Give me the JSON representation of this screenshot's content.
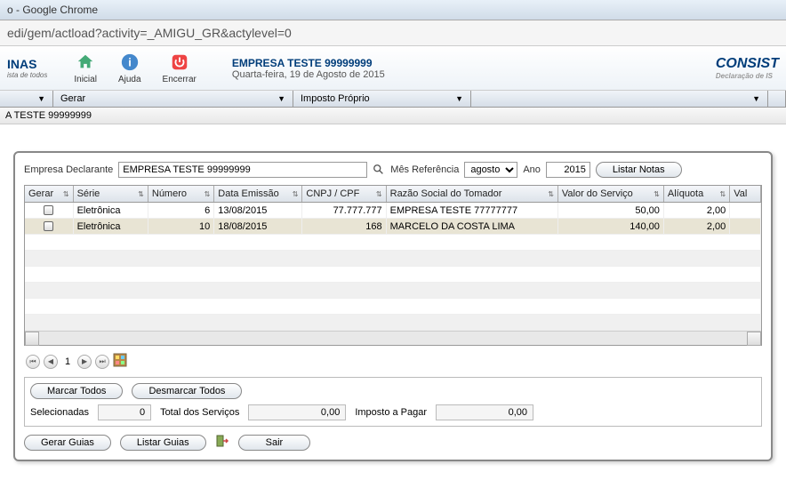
{
  "browser": {
    "title_suffix": "o - Google Chrome",
    "url": "edi/gem/actload?activity=_AMIGU_GR&actylevel=0"
  },
  "header": {
    "logo_main": "INAS",
    "logo_sub": "ista de todos",
    "buttons": {
      "inicial": "Inicial",
      "ajuda": "Ajuda",
      "encerrar": "Encerrar"
    },
    "company": "EMPRESA TESTE 99999999",
    "date": "Quarta-feira, 19 de Agosto de 2015",
    "right_logo": "CONSIST",
    "right_logo_sub": "Declaração de IS"
  },
  "menu": {
    "gerar": "Gerar",
    "imposto": "Imposto Próprio"
  },
  "subbar": "A TESTE 99999999",
  "filters": {
    "declarante_label": "Empresa Declarante",
    "declarante_value": "EMPRESA TESTE 99999999",
    "mes_label": "Mês Referência",
    "mes_value": "agosto",
    "ano_label": "Ano",
    "ano_value": "2015",
    "listar_btn": "Listar Notas"
  },
  "columns": {
    "gerar": "Gerar",
    "serie": "Série",
    "numero": "Número",
    "data": "Data Emissão",
    "cnpj": "CNPJ / CPF",
    "razao": "Razão Social do Tomador",
    "valor": "Valor do Serviço",
    "aliquota": "Alíquota",
    "val": "Val"
  },
  "rows": [
    {
      "serie": "Eletrônica",
      "numero": "6",
      "data": "13/08/2015",
      "cnpj": "77.777.777",
      "razao": "EMPRESA TESTE 77777777",
      "valor": "50,00",
      "aliquota": "2,00"
    },
    {
      "serie": "Eletrônica",
      "numero": "10",
      "data": "18/08/2015",
      "cnpj": "168",
      "razao": "MARCELO DA COSTA LIMA",
      "valor": "140,00",
      "aliquota": "2,00"
    }
  ],
  "pager": {
    "page": "1"
  },
  "summary": {
    "marcar_btn": "Marcar Todos",
    "desmarcar_btn": "Desmarcar Todos",
    "selecionadas_label": "Selecionadas",
    "selecionadas_value": "0",
    "total_label": "Total dos Serviços",
    "total_value": "0,00",
    "imposto_label": "Imposto a Pagar",
    "imposto_value": "0,00"
  },
  "actions": {
    "gerar_guias": "Gerar Guias",
    "listar_guias": "Listar Guias",
    "sair": "Sair"
  }
}
